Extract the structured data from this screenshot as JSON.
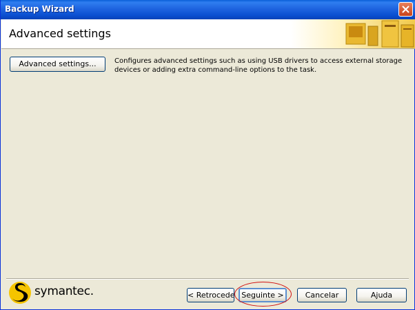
{
  "window": {
    "title": "Backup Wizard"
  },
  "header": {
    "title": "Advanced settings"
  },
  "content": {
    "advanced_button_label": "Advanced settings...",
    "description_line1": "Configures advanced settings such as using USB drivers to access external storage",
    "description_line2": "devices or adding extra command-line options to the task."
  },
  "footer": {
    "logo_text": "symantec.",
    "back_label": "< Retroceder",
    "next_label": "Seguinte >",
    "cancel_label": "Cancelar",
    "help_label": "Ajuda"
  },
  "colors": {
    "titlebar": "#0a4fd0",
    "background": "#ece9d8",
    "highlight": "#d01010",
    "logo_yellow": "#f5c400"
  },
  "icons": [
    "close-icon",
    "computer-illustration-icon",
    "symantec-logo-icon"
  ]
}
